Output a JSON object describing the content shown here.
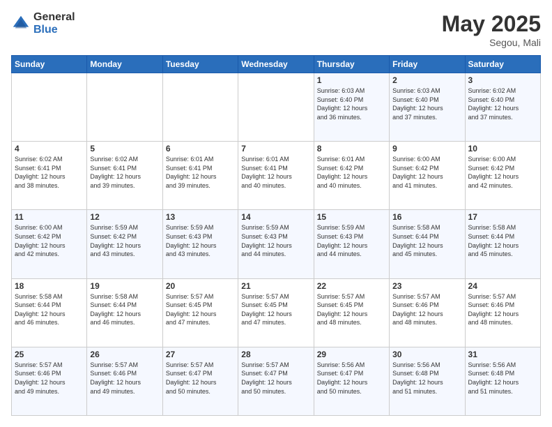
{
  "logo": {
    "general": "General",
    "blue": "Blue"
  },
  "title": {
    "month_year": "May 2025",
    "location": "Segou, Mali"
  },
  "days_of_week": [
    "Sunday",
    "Monday",
    "Tuesday",
    "Wednesday",
    "Thursday",
    "Friday",
    "Saturday"
  ],
  "weeks": [
    [
      {
        "day": "",
        "info": ""
      },
      {
        "day": "",
        "info": ""
      },
      {
        "day": "",
        "info": ""
      },
      {
        "day": "",
        "info": ""
      },
      {
        "day": "1",
        "info": "Sunrise: 6:03 AM\nSunset: 6:40 PM\nDaylight: 12 hours\nand 36 minutes."
      },
      {
        "day": "2",
        "info": "Sunrise: 6:03 AM\nSunset: 6:40 PM\nDaylight: 12 hours\nand 37 minutes."
      },
      {
        "day": "3",
        "info": "Sunrise: 6:02 AM\nSunset: 6:40 PM\nDaylight: 12 hours\nand 37 minutes."
      }
    ],
    [
      {
        "day": "4",
        "info": "Sunrise: 6:02 AM\nSunset: 6:41 PM\nDaylight: 12 hours\nand 38 minutes."
      },
      {
        "day": "5",
        "info": "Sunrise: 6:02 AM\nSunset: 6:41 PM\nDaylight: 12 hours\nand 39 minutes."
      },
      {
        "day": "6",
        "info": "Sunrise: 6:01 AM\nSunset: 6:41 PM\nDaylight: 12 hours\nand 39 minutes."
      },
      {
        "day": "7",
        "info": "Sunrise: 6:01 AM\nSunset: 6:41 PM\nDaylight: 12 hours\nand 40 minutes."
      },
      {
        "day": "8",
        "info": "Sunrise: 6:01 AM\nSunset: 6:42 PM\nDaylight: 12 hours\nand 40 minutes."
      },
      {
        "day": "9",
        "info": "Sunrise: 6:00 AM\nSunset: 6:42 PM\nDaylight: 12 hours\nand 41 minutes."
      },
      {
        "day": "10",
        "info": "Sunrise: 6:00 AM\nSunset: 6:42 PM\nDaylight: 12 hours\nand 42 minutes."
      }
    ],
    [
      {
        "day": "11",
        "info": "Sunrise: 6:00 AM\nSunset: 6:42 PM\nDaylight: 12 hours\nand 42 minutes."
      },
      {
        "day": "12",
        "info": "Sunrise: 5:59 AM\nSunset: 6:42 PM\nDaylight: 12 hours\nand 43 minutes."
      },
      {
        "day": "13",
        "info": "Sunrise: 5:59 AM\nSunset: 6:43 PM\nDaylight: 12 hours\nand 43 minutes."
      },
      {
        "day": "14",
        "info": "Sunrise: 5:59 AM\nSunset: 6:43 PM\nDaylight: 12 hours\nand 44 minutes."
      },
      {
        "day": "15",
        "info": "Sunrise: 5:59 AM\nSunset: 6:43 PM\nDaylight: 12 hours\nand 44 minutes."
      },
      {
        "day": "16",
        "info": "Sunrise: 5:58 AM\nSunset: 6:44 PM\nDaylight: 12 hours\nand 45 minutes."
      },
      {
        "day": "17",
        "info": "Sunrise: 5:58 AM\nSunset: 6:44 PM\nDaylight: 12 hours\nand 45 minutes."
      }
    ],
    [
      {
        "day": "18",
        "info": "Sunrise: 5:58 AM\nSunset: 6:44 PM\nDaylight: 12 hours\nand 46 minutes."
      },
      {
        "day": "19",
        "info": "Sunrise: 5:58 AM\nSunset: 6:44 PM\nDaylight: 12 hours\nand 46 minutes."
      },
      {
        "day": "20",
        "info": "Sunrise: 5:57 AM\nSunset: 6:45 PM\nDaylight: 12 hours\nand 47 minutes."
      },
      {
        "day": "21",
        "info": "Sunrise: 5:57 AM\nSunset: 6:45 PM\nDaylight: 12 hours\nand 47 minutes."
      },
      {
        "day": "22",
        "info": "Sunrise: 5:57 AM\nSunset: 6:45 PM\nDaylight: 12 hours\nand 48 minutes."
      },
      {
        "day": "23",
        "info": "Sunrise: 5:57 AM\nSunset: 6:46 PM\nDaylight: 12 hours\nand 48 minutes."
      },
      {
        "day": "24",
        "info": "Sunrise: 5:57 AM\nSunset: 6:46 PM\nDaylight: 12 hours\nand 48 minutes."
      }
    ],
    [
      {
        "day": "25",
        "info": "Sunrise: 5:57 AM\nSunset: 6:46 PM\nDaylight: 12 hours\nand 49 minutes."
      },
      {
        "day": "26",
        "info": "Sunrise: 5:57 AM\nSunset: 6:46 PM\nDaylight: 12 hours\nand 49 minutes."
      },
      {
        "day": "27",
        "info": "Sunrise: 5:57 AM\nSunset: 6:47 PM\nDaylight: 12 hours\nand 50 minutes."
      },
      {
        "day": "28",
        "info": "Sunrise: 5:57 AM\nSunset: 6:47 PM\nDaylight: 12 hours\nand 50 minutes."
      },
      {
        "day": "29",
        "info": "Sunrise: 5:56 AM\nSunset: 6:47 PM\nDaylight: 12 hours\nand 50 minutes."
      },
      {
        "day": "30",
        "info": "Sunrise: 5:56 AM\nSunset: 6:48 PM\nDaylight: 12 hours\nand 51 minutes."
      },
      {
        "day": "31",
        "info": "Sunrise: 5:56 AM\nSunset: 6:48 PM\nDaylight: 12 hours\nand 51 minutes."
      }
    ]
  ]
}
